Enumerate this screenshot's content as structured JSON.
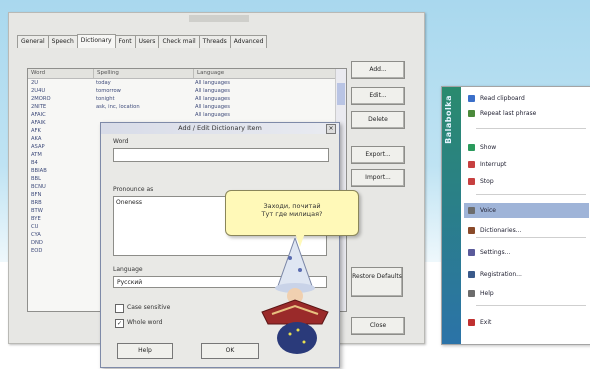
{
  "dialog": {
    "tabs": [
      "General",
      "Speech",
      "Dictionary",
      "Font",
      "Users",
      "Check mail",
      "Threads",
      "Advanced"
    ],
    "active_tab": "Dictionary",
    "list_headers": [
      "Word",
      "Spelling",
      "Language"
    ],
    "rows": [
      [
        "2U",
        "today",
        "All languages"
      ],
      [
        "2U4U",
        "tomorrow",
        "All languages"
      ],
      [
        "2MORO",
        "tonight",
        "All languages"
      ],
      [
        "2NITE",
        "ask, inc, location",
        "All languages"
      ],
      [
        "AFAIC",
        "",
        "All languages"
      ],
      [
        "AFAIK",
        "",
        ""
      ],
      [
        "AFK",
        "",
        ""
      ],
      [
        "AKA",
        "",
        ""
      ],
      [
        "ASAP",
        "",
        ""
      ],
      [
        "ATM",
        "",
        ""
      ],
      [
        "B4",
        "",
        ""
      ],
      [
        "BBIAB",
        "",
        ""
      ],
      [
        "BBL",
        "",
        ""
      ],
      [
        "BCNU",
        "",
        ""
      ],
      [
        "BFN",
        "",
        ""
      ],
      [
        "BRB",
        "",
        ""
      ],
      [
        "BTW",
        "",
        ""
      ],
      [
        "BYE",
        "",
        ""
      ],
      [
        "CU",
        "",
        ""
      ],
      [
        "CYA",
        "",
        ""
      ],
      [
        "DND",
        "",
        ""
      ],
      [
        "EOD",
        "",
        ""
      ]
    ],
    "buttons": {
      "add": "Add...",
      "edit": "Edit...",
      "delete": "Delete",
      "export": "Export...",
      "import": "Import...",
      "restore": "Restore Defaults",
      "close": "Close"
    }
  },
  "sub_dialog": {
    "title": "Add / Edit Dictionary Item",
    "word_label": "Word",
    "word_value": "",
    "pron_label": "Pronounce as",
    "pron_value": "Oneness",
    "lang_label": "Language",
    "lang_value": "Русский",
    "case_label": "Case sensitive",
    "whole_label": "Whole word",
    "help": "Help",
    "ok": "OK"
  },
  "tooltip": {
    "line1": "Заходи, почитай",
    "line2": "Тут где милицая?"
  },
  "menu": {
    "side_label": "Balabolka",
    "items": [
      {
        "label": "Read clipboard",
        "icon": "clipboard-icon",
        "color": "#3b6fc9"
      },
      {
        "label": "Repeat last phrase",
        "icon": "repeat-icon",
        "color": "#4b8a3b"
      },
      {
        "label": "Show",
        "icon": "show-icon",
        "color": "#2a9a5c"
      },
      {
        "label": "Interrupt",
        "icon": "interrupt-icon",
        "color": "#c74040"
      },
      {
        "label": "Stop",
        "icon": "stop-icon",
        "color": "#c74040"
      },
      {
        "label": "Voice",
        "icon": "voice-icon",
        "color": "#6c6c6c"
      },
      {
        "label": "Dictionaries...",
        "icon": "dictionary-icon",
        "color": "#8a4a2a"
      },
      {
        "label": "Settings...",
        "icon": "settings-icon",
        "color": "#5a5a9a"
      },
      {
        "label": "Registration...",
        "icon": "registration-icon",
        "color": "#3a5a8a"
      },
      {
        "label": "Help",
        "icon": "help-icon",
        "color": "#6c6c6c"
      },
      {
        "label": "Exit",
        "icon": "exit-icon",
        "color": "#c03030"
      }
    ],
    "highlight": "Voice"
  }
}
